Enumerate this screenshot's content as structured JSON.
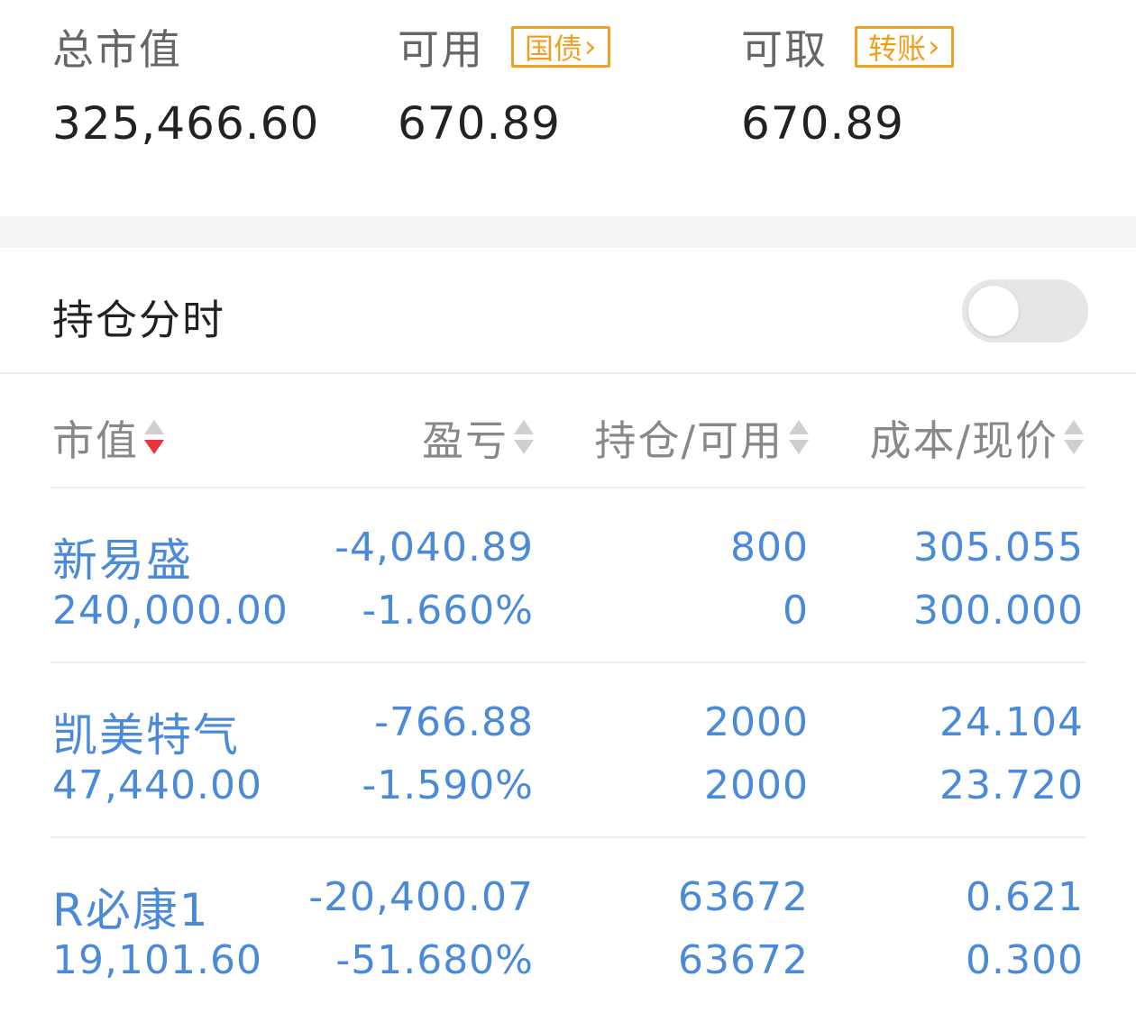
{
  "summary": {
    "total_market_value_label": "总市值",
    "total_market_value": "325,466.60",
    "available_label": "可用",
    "available_tag": "国债",
    "available_value": "670.89",
    "withdrawable_label": "可取",
    "withdrawable_tag": "转账",
    "withdrawable_value": "670.89",
    "tag_color": "#f0a020"
  },
  "toggle": {
    "label": "持仓分时",
    "on": false
  },
  "table": {
    "headers": {
      "market_value": "市值",
      "profit_loss": "盈亏",
      "position_available": "持仓/可用",
      "cost_price": "成本/现价"
    },
    "sort_active": "market_value",
    "sort_direction": "desc",
    "text_color": "#4a8ad8",
    "rows": [
      {
        "name": "新易盛",
        "market_value": "240,000.00",
        "pl_amount": "-4,040.89",
        "pl_percent": "-1.660%",
        "position": "800",
        "available": "0",
        "cost": "305.055",
        "price": "300.000"
      },
      {
        "name": "凯美特气",
        "market_value": "47,440.00",
        "pl_amount": "-766.88",
        "pl_percent": "-1.590%",
        "position": "2000",
        "available": "2000",
        "cost": "24.104",
        "price": "23.720"
      },
      {
        "name": "R必康1",
        "market_value": "19,101.60",
        "pl_amount": "-20,400.07",
        "pl_percent": "-51.680%",
        "position": "63672",
        "available": "63672",
        "cost": "0.621",
        "price": "0.300"
      }
    ]
  }
}
